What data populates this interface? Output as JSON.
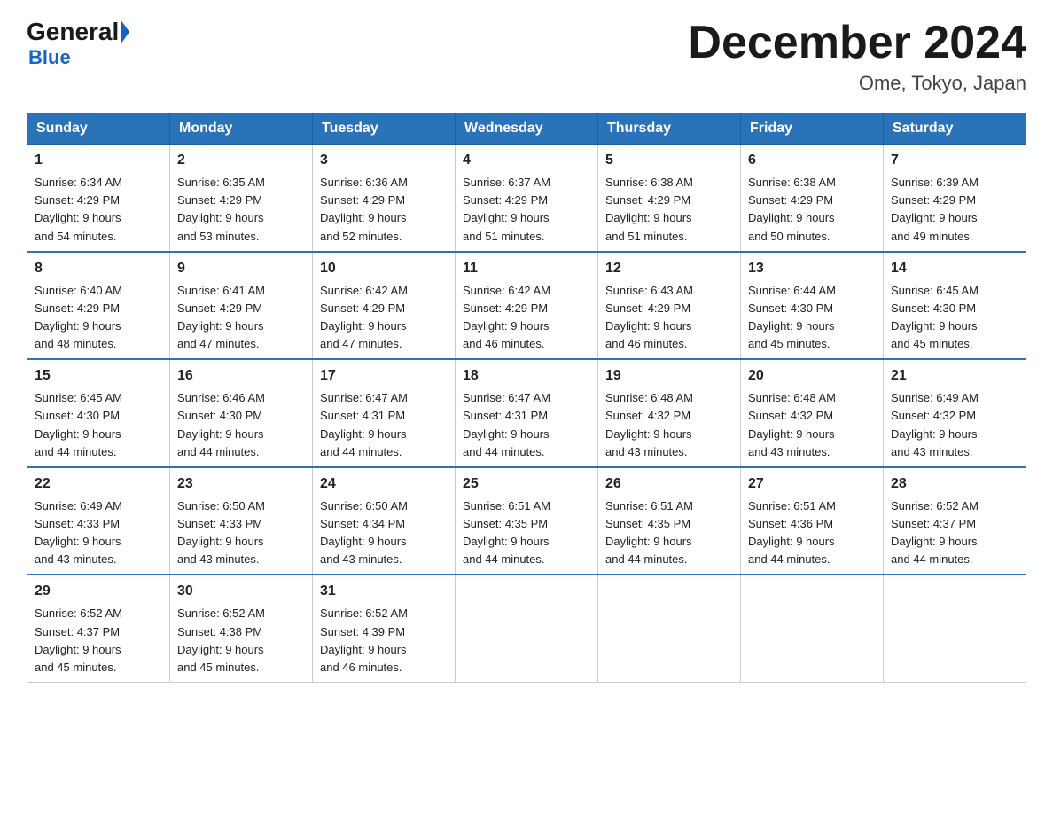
{
  "header": {
    "logo_general": "General",
    "logo_blue": "Blue",
    "title": "December 2024",
    "subtitle": "Ome, Tokyo, Japan"
  },
  "columns": [
    "Sunday",
    "Monday",
    "Tuesday",
    "Wednesday",
    "Thursday",
    "Friday",
    "Saturday"
  ],
  "weeks": [
    [
      {
        "day": "1",
        "sunrise": "6:34 AM",
        "sunset": "4:29 PM",
        "daylight": "9 hours and 54 minutes."
      },
      {
        "day": "2",
        "sunrise": "6:35 AM",
        "sunset": "4:29 PM",
        "daylight": "9 hours and 53 minutes."
      },
      {
        "day": "3",
        "sunrise": "6:36 AM",
        "sunset": "4:29 PM",
        "daylight": "9 hours and 52 minutes."
      },
      {
        "day": "4",
        "sunrise": "6:37 AM",
        "sunset": "4:29 PM",
        "daylight": "9 hours and 51 minutes."
      },
      {
        "day": "5",
        "sunrise": "6:38 AM",
        "sunset": "4:29 PM",
        "daylight": "9 hours and 51 minutes."
      },
      {
        "day": "6",
        "sunrise": "6:38 AM",
        "sunset": "4:29 PM",
        "daylight": "9 hours and 50 minutes."
      },
      {
        "day": "7",
        "sunrise": "6:39 AM",
        "sunset": "4:29 PM",
        "daylight": "9 hours and 49 minutes."
      }
    ],
    [
      {
        "day": "8",
        "sunrise": "6:40 AM",
        "sunset": "4:29 PM",
        "daylight": "9 hours and 48 minutes."
      },
      {
        "day": "9",
        "sunrise": "6:41 AM",
        "sunset": "4:29 PM",
        "daylight": "9 hours and 47 minutes."
      },
      {
        "day": "10",
        "sunrise": "6:42 AM",
        "sunset": "4:29 PM",
        "daylight": "9 hours and 47 minutes."
      },
      {
        "day": "11",
        "sunrise": "6:42 AM",
        "sunset": "4:29 PM",
        "daylight": "9 hours and 46 minutes."
      },
      {
        "day": "12",
        "sunrise": "6:43 AM",
        "sunset": "4:29 PM",
        "daylight": "9 hours and 46 minutes."
      },
      {
        "day": "13",
        "sunrise": "6:44 AM",
        "sunset": "4:30 PM",
        "daylight": "9 hours and 45 minutes."
      },
      {
        "day": "14",
        "sunrise": "6:45 AM",
        "sunset": "4:30 PM",
        "daylight": "9 hours and 45 minutes."
      }
    ],
    [
      {
        "day": "15",
        "sunrise": "6:45 AM",
        "sunset": "4:30 PM",
        "daylight": "9 hours and 44 minutes."
      },
      {
        "day": "16",
        "sunrise": "6:46 AM",
        "sunset": "4:30 PM",
        "daylight": "9 hours and 44 minutes."
      },
      {
        "day": "17",
        "sunrise": "6:47 AM",
        "sunset": "4:31 PM",
        "daylight": "9 hours and 44 minutes."
      },
      {
        "day": "18",
        "sunrise": "6:47 AM",
        "sunset": "4:31 PM",
        "daylight": "9 hours and 44 minutes."
      },
      {
        "day": "19",
        "sunrise": "6:48 AM",
        "sunset": "4:32 PM",
        "daylight": "9 hours and 43 minutes."
      },
      {
        "day": "20",
        "sunrise": "6:48 AM",
        "sunset": "4:32 PM",
        "daylight": "9 hours and 43 minutes."
      },
      {
        "day": "21",
        "sunrise": "6:49 AM",
        "sunset": "4:32 PM",
        "daylight": "9 hours and 43 minutes."
      }
    ],
    [
      {
        "day": "22",
        "sunrise": "6:49 AM",
        "sunset": "4:33 PM",
        "daylight": "9 hours and 43 minutes."
      },
      {
        "day": "23",
        "sunrise": "6:50 AM",
        "sunset": "4:33 PM",
        "daylight": "9 hours and 43 minutes."
      },
      {
        "day": "24",
        "sunrise": "6:50 AM",
        "sunset": "4:34 PM",
        "daylight": "9 hours and 43 minutes."
      },
      {
        "day": "25",
        "sunrise": "6:51 AM",
        "sunset": "4:35 PM",
        "daylight": "9 hours and 44 minutes."
      },
      {
        "day": "26",
        "sunrise": "6:51 AM",
        "sunset": "4:35 PM",
        "daylight": "9 hours and 44 minutes."
      },
      {
        "day": "27",
        "sunrise": "6:51 AM",
        "sunset": "4:36 PM",
        "daylight": "9 hours and 44 minutes."
      },
      {
        "day": "28",
        "sunrise": "6:52 AM",
        "sunset": "4:37 PM",
        "daylight": "9 hours and 44 minutes."
      }
    ],
    [
      {
        "day": "29",
        "sunrise": "6:52 AM",
        "sunset": "4:37 PM",
        "daylight": "9 hours and 45 minutes."
      },
      {
        "day": "30",
        "sunrise": "6:52 AM",
        "sunset": "4:38 PM",
        "daylight": "9 hours and 45 minutes."
      },
      {
        "day": "31",
        "sunrise": "6:52 AM",
        "sunset": "4:39 PM",
        "daylight": "9 hours and 46 minutes."
      },
      null,
      null,
      null,
      null
    ]
  ],
  "labels": {
    "sunrise": "Sunrise:",
    "sunset": "Sunset:",
    "daylight": "Daylight:"
  }
}
